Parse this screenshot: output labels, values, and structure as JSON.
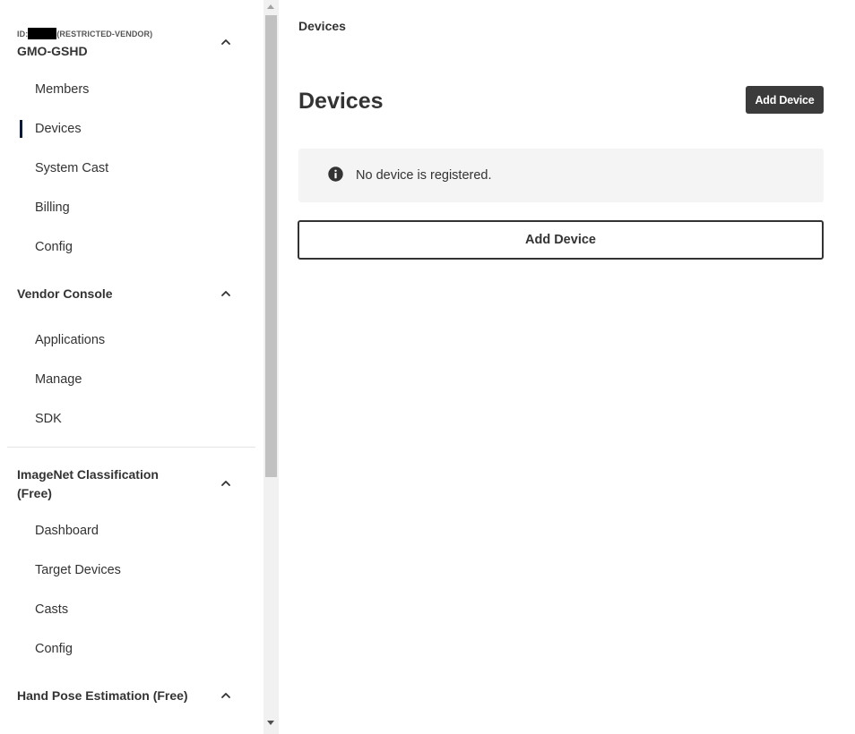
{
  "sidebar": {
    "org": {
      "id_prefix": "ID:",
      "id_suffix": "(RESTRICTED-VENDOR)",
      "name": "GMO-GSHD",
      "items": [
        {
          "label": "Members"
        },
        {
          "label": "Devices"
        },
        {
          "label": "System Cast"
        },
        {
          "label": "Billing"
        },
        {
          "label": "Config"
        }
      ],
      "active_item": "Devices"
    },
    "vendor_console": {
      "title": "Vendor Console",
      "items": [
        {
          "label": "Applications"
        },
        {
          "label": "Manage"
        },
        {
          "label": "SDK"
        }
      ]
    },
    "imagenet": {
      "title_line1": "ImageNet Classification",
      "title_line2": "(Free)",
      "items": [
        {
          "label": "Dashboard"
        },
        {
          "label": "Target Devices"
        },
        {
          "label": "Casts"
        },
        {
          "label": "Config"
        }
      ]
    },
    "hand_pose": {
      "title": "Hand Pose Estimation (Free)"
    },
    "icons": {
      "collapse": "chevron-up-icon"
    }
  },
  "main": {
    "breadcrumb": "Devices",
    "title": "Devices",
    "add_device_label": "Add Device",
    "notice": {
      "icon": "info-icon",
      "text": "No device is registered."
    },
    "add_device_outline_label": "Add Device"
  },
  "colors": {
    "active_indicator": "#0b1a3a",
    "primary_button": "#3b3b3b",
    "notice_bg": "#f4f4f4",
    "text": "#333333"
  }
}
